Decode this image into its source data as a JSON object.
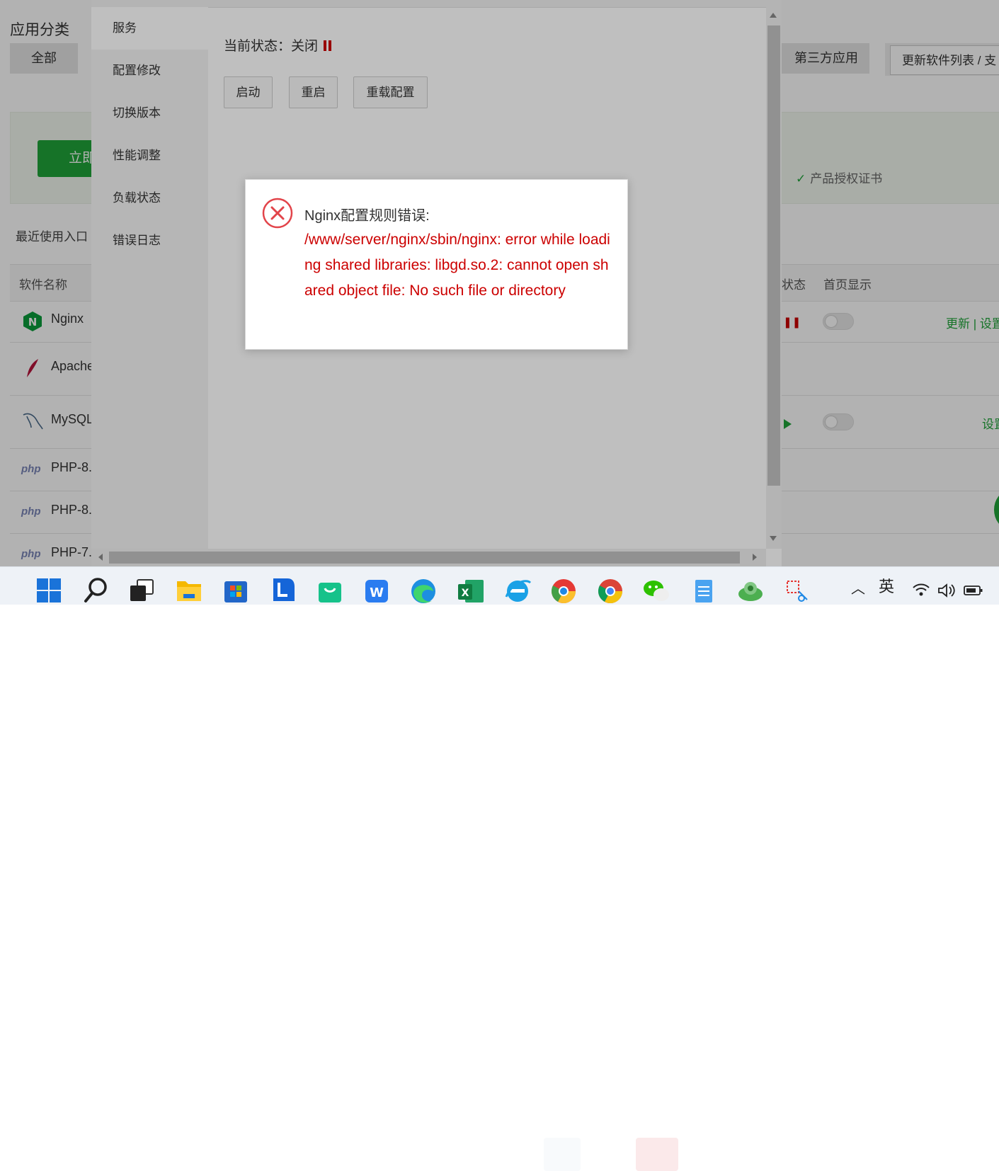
{
  "background": {
    "title": "应用分类",
    "categories": [
      {
        "label": "全部"
      },
      {
        "label": "第三方应用"
      }
    ],
    "update_button": "更新软件列表 / 支",
    "promo_button": "立即",
    "license_text": "产品授权证书",
    "recent_label": "最近使用入口",
    "table_headers": {
      "name": "软件名称",
      "status": "状态",
      "homepage": "首页显示"
    },
    "rows": [
      {
        "name": "Nginx",
        "ops": "更新 | 设置"
      },
      {
        "name": "Apache",
        "ops": ""
      },
      {
        "name": "MySQL",
        "ops": "设置"
      },
      {
        "name": "PHP-8.",
        "ops": ""
      },
      {
        "name": "PHP-8.",
        "ops": ""
      },
      {
        "name": "PHP-7.",
        "ops": ""
      }
    ]
  },
  "modal": {
    "menu": [
      "服务",
      "配置修改",
      "切换版本",
      "性能调整",
      "负载状态",
      "错误日志"
    ],
    "active_menu": "服务",
    "status_label": "当前状态：",
    "status_value": "关闭",
    "buttons": {
      "start": "启动",
      "restart": "重启",
      "reload": "重载配置"
    }
  },
  "error_dialog": {
    "title": "Nginx配置规则错误:",
    "message": "/www/server/nginx/sbin/nginx: error while loading shared libraries: libgd.so.2: cannot open shared object file: No such file or directory"
  },
  "taskbar": {
    "apps": [
      "start-icon",
      "search-icon",
      "task-view-icon",
      "file-explorer-icon",
      "store-icon",
      "lenovo-icon",
      "shopping-bag-icon",
      "wps-icon",
      "edge-icon",
      "excel-icon",
      "ie-icon",
      "chrome-beta-icon",
      "chrome-icon",
      "wechat-icon",
      "notepad-icon",
      "network-app-icon",
      "snip-tool-icon"
    ],
    "ime_label": "英"
  },
  "colors": {
    "accent_green": "#20a53a",
    "error_red": "#cc0000"
  }
}
